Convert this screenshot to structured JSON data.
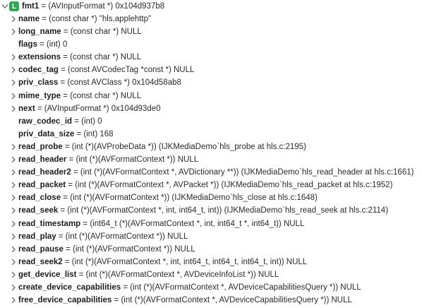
{
  "root": {
    "badge": "L",
    "name": "fmt1",
    "value": " = (AVInputFormat *) 0x104d937b8"
  },
  "fields": [
    {
      "name": "name",
      "value": " = (const char *) \"hls,applehttp\"",
      "expandable": true
    },
    {
      "name": "long_name",
      "value": " = (const char *) NULL",
      "expandable": true
    },
    {
      "name": "flags",
      "value": " = (int) 0",
      "expandable": false
    },
    {
      "name": "extensions",
      "value": " = (const char *) NULL",
      "expandable": true
    },
    {
      "name": "codec_tag",
      "value": " = (const AVCodecTag *const *) NULL",
      "expandable": true
    },
    {
      "name": "priv_class",
      "value": " = (const AVClass *) 0x104d58ab8",
      "expandable": true
    },
    {
      "name": "mime_type",
      "value": " = (const char *) NULL",
      "expandable": true
    },
    {
      "name": "next",
      "value": " = (AVInputFormat *) 0x104d93de0",
      "expandable": true
    },
    {
      "name": "raw_codec_id",
      "value": " = (int) 0",
      "expandable": false
    },
    {
      "name": "priv_data_size",
      "value": " = (int) 168",
      "expandable": false
    },
    {
      "name": "read_probe",
      "value": " = (int (*)(AVProbeData *)) (IJKMediaDemo`hls_probe at hls.c:2195)",
      "expandable": true
    },
    {
      "name": "read_header",
      "value": " = (int (*)(AVFormatContext *)) NULL",
      "expandable": true
    },
    {
      "name": "read_header2",
      "value": " = (int (*)(AVFormatContext *, AVDictionary **)) (IJKMediaDemo`hls_read_header at hls.c:1661)",
      "expandable": true
    },
    {
      "name": "read_packet",
      "value": " = (int (*)(AVFormatContext *, AVPacket *)) (IJKMediaDemo`hls_read_packet at hls.c:1952)",
      "expandable": true
    },
    {
      "name": "read_close",
      "value": " = (int (*)(AVFormatContext *)) (IJKMediaDemo`hls_close at hls.c:1648)",
      "expandable": true
    },
    {
      "name": "read_seek",
      "value": " = (int (*)(AVFormatContext *, int, int64_t, int)) (IJKMediaDemo`hls_read_seek at hls.c:2114)",
      "expandable": true
    },
    {
      "name": "read_timestamp",
      "value": " = (int64_t (*)(AVFormatContext *, int, int64_t *, int64_t)) NULL",
      "expandable": true
    },
    {
      "name": "read_play",
      "value": " = (int (*)(AVFormatContext *)) NULL",
      "expandable": true
    },
    {
      "name": "read_pause",
      "value": " = (int (*)(AVFormatContext *)) NULL",
      "expandable": true
    },
    {
      "name": "read_seek2",
      "value": " = (int (*)(AVFormatContext *, int, int64_t, int64_t, int64_t, int)) NULL",
      "expandable": true
    },
    {
      "name": "get_device_list",
      "value": " = (int (*)(AVFormatContext *, AVDeviceInfoList *)) NULL",
      "expandable": true
    },
    {
      "name": "create_device_capabilities",
      "value": " = (int (*)(AVFormatContext *, AVDeviceCapabilitiesQuery *)) NULL",
      "expandable": true
    },
    {
      "name": "free_device_capabilities",
      "value": " = (int (*)(AVFormatContext *, AVDeviceCapabilitiesQuery *)) NULL",
      "expandable": true
    }
  ],
  "colors": {
    "badge": "#2fa84f",
    "chevron": "#6e6e6e"
  },
  "icons": {
    "root_chevron": "chevron-down-icon",
    "row_chevron": "chevron-right-icon"
  }
}
